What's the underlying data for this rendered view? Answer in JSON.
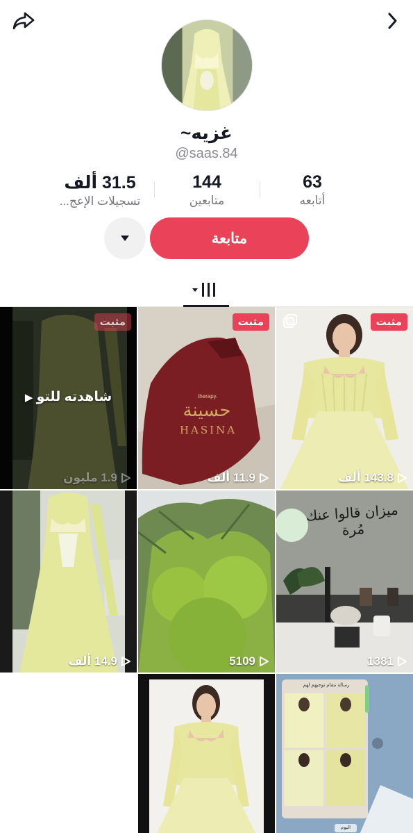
{
  "header": {
    "share_icon": "share-arrow-icon",
    "back_icon": "chevron-right-icon"
  },
  "profile": {
    "display_name": "غزيه~",
    "handle": "@saas.84"
  },
  "stats": {
    "likes": {
      "value": "31.5 ألف",
      "label": "تسجيلات الإعج..."
    },
    "followers": {
      "value": "144",
      "label": "متابعين"
    },
    "following": {
      "value": "63",
      "label": "أتابعه"
    }
  },
  "actions": {
    "follow_label": "متابعة",
    "dropdown_icon": "caret-down-icon"
  },
  "tabs": {
    "grid_icon": "video-grid-icon"
  },
  "colors": {
    "accent": "#ea4359"
  },
  "videos": [
    {
      "pinned": "مثبت",
      "views": "143.8 ألف",
      "multi": true
    },
    {
      "pinned": "مثبت",
      "views": "11.9 ألف",
      "product_text_ar": "حسينة",
      "product_text_en": "HASINA",
      "product_brand": "therapy."
    },
    {
      "pinned": "مثبت",
      "views": "1.9 مليون",
      "watched": "شاهدته للتو"
    },
    {
      "views": "1381",
      "wall_text": "ميزان قالوا عنك مُرة"
    },
    {
      "views": "5109"
    },
    {
      "views": "14.9 ألف"
    },
    {
      "chat_title": "رسالة تنقام توجيهم لهم",
      "chat_day": "اليوم"
    },
    {}
  ]
}
